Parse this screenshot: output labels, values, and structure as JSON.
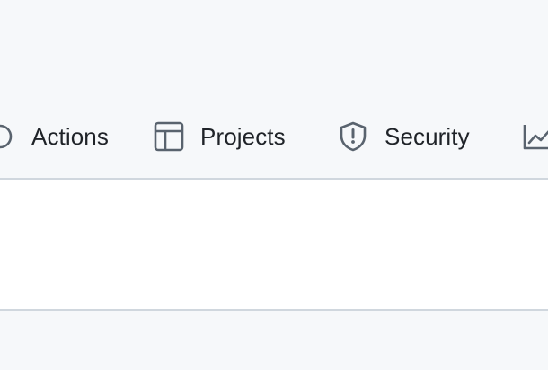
{
  "repo_nav": {
    "items": [
      {
        "label": "Actions",
        "icon": "actions-icon"
      },
      {
        "label": "Projects",
        "icon": "projects-table-icon"
      },
      {
        "label": "Security",
        "icon": "shield-alert-icon"
      },
      {
        "label": "",
        "icon": "insights-graph-icon"
      }
    ]
  },
  "colors": {
    "nav_background": "#f6f8fa",
    "text": "#1f2328",
    "icon": "#59636e",
    "border": "#d0d7de",
    "content_background": "#ffffff"
  }
}
